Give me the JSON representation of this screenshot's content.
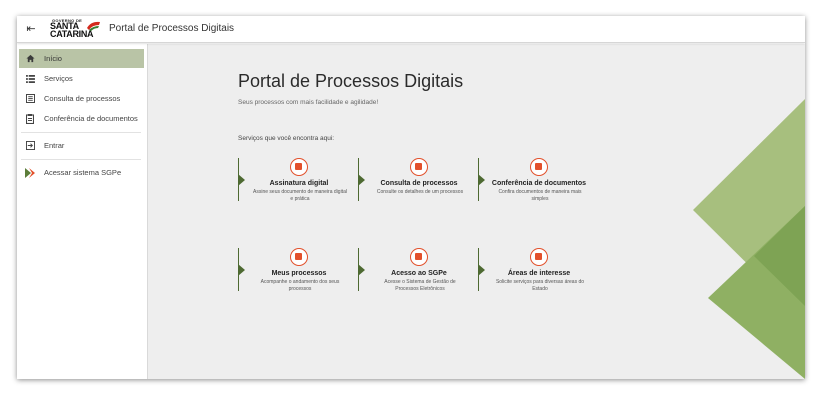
{
  "header": {
    "logo": {
      "top": "GOVERNO DE",
      "line1": "SANTA",
      "line2": "CATARINA"
    },
    "title": "Portal de Processos Digitais"
  },
  "sidebar": {
    "items": [
      {
        "label": "Início",
        "icon": "home-icon",
        "active": true
      },
      {
        "label": "Serviços",
        "icon": "list-icon"
      },
      {
        "label": "Consulta de processos",
        "icon": "document-list-icon"
      },
      {
        "label": "Conferência de documentos",
        "icon": "clipboard-icon"
      },
      {
        "label": "Entrar",
        "icon": "login-icon"
      },
      {
        "label": "Acessar sistema SGPe",
        "icon": "sgpe-logo-icon"
      }
    ]
  },
  "main": {
    "title": "Portal de Processos Digitais",
    "subtitle": "Seus processos com mais facilidade e agilidade!",
    "section_label": "Serviços que você encontra aqui:",
    "cards": [
      {
        "title": "Assinatura digital",
        "desc": "Assine seus documento de maneira digital e prática",
        "icon": "pen-icon"
      },
      {
        "title": "Consulta de processos",
        "desc": "Consulte os detalhes de um processos",
        "icon": "document-icon"
      },
      {
        "title": "Conferência de documentos",
        "desc": "Confira documentos de maneira mais simples",
        "icon": "clipboard-icon"
      },
      {
        "title": "Meus processos",
        "desc": "Acompanhe o andamento dos seus processos",
        "icon": "folder-icon"
      },
      {
        "title": "Acesso ao SGPe",
        "desc": "Acesse o Sistema de Gestão de Processos Eletrônicos",
        "icon": "sgpe-icon"
      },
      {
        "title": "Áreas de interesse",
        "desc": "Solicite serviços para diversas áreas do Estado",
        "icon": "grid-icon"
      }
    ]
  },
  "colors": {
    "accent": "#e2502b",
    "green_dark": "#4e6a32",
    "sidebar_active": "#b9c4a6",
    "deco_light": "#a7bf7e",
    "deco_dark": "#7ea354"
  }
}
